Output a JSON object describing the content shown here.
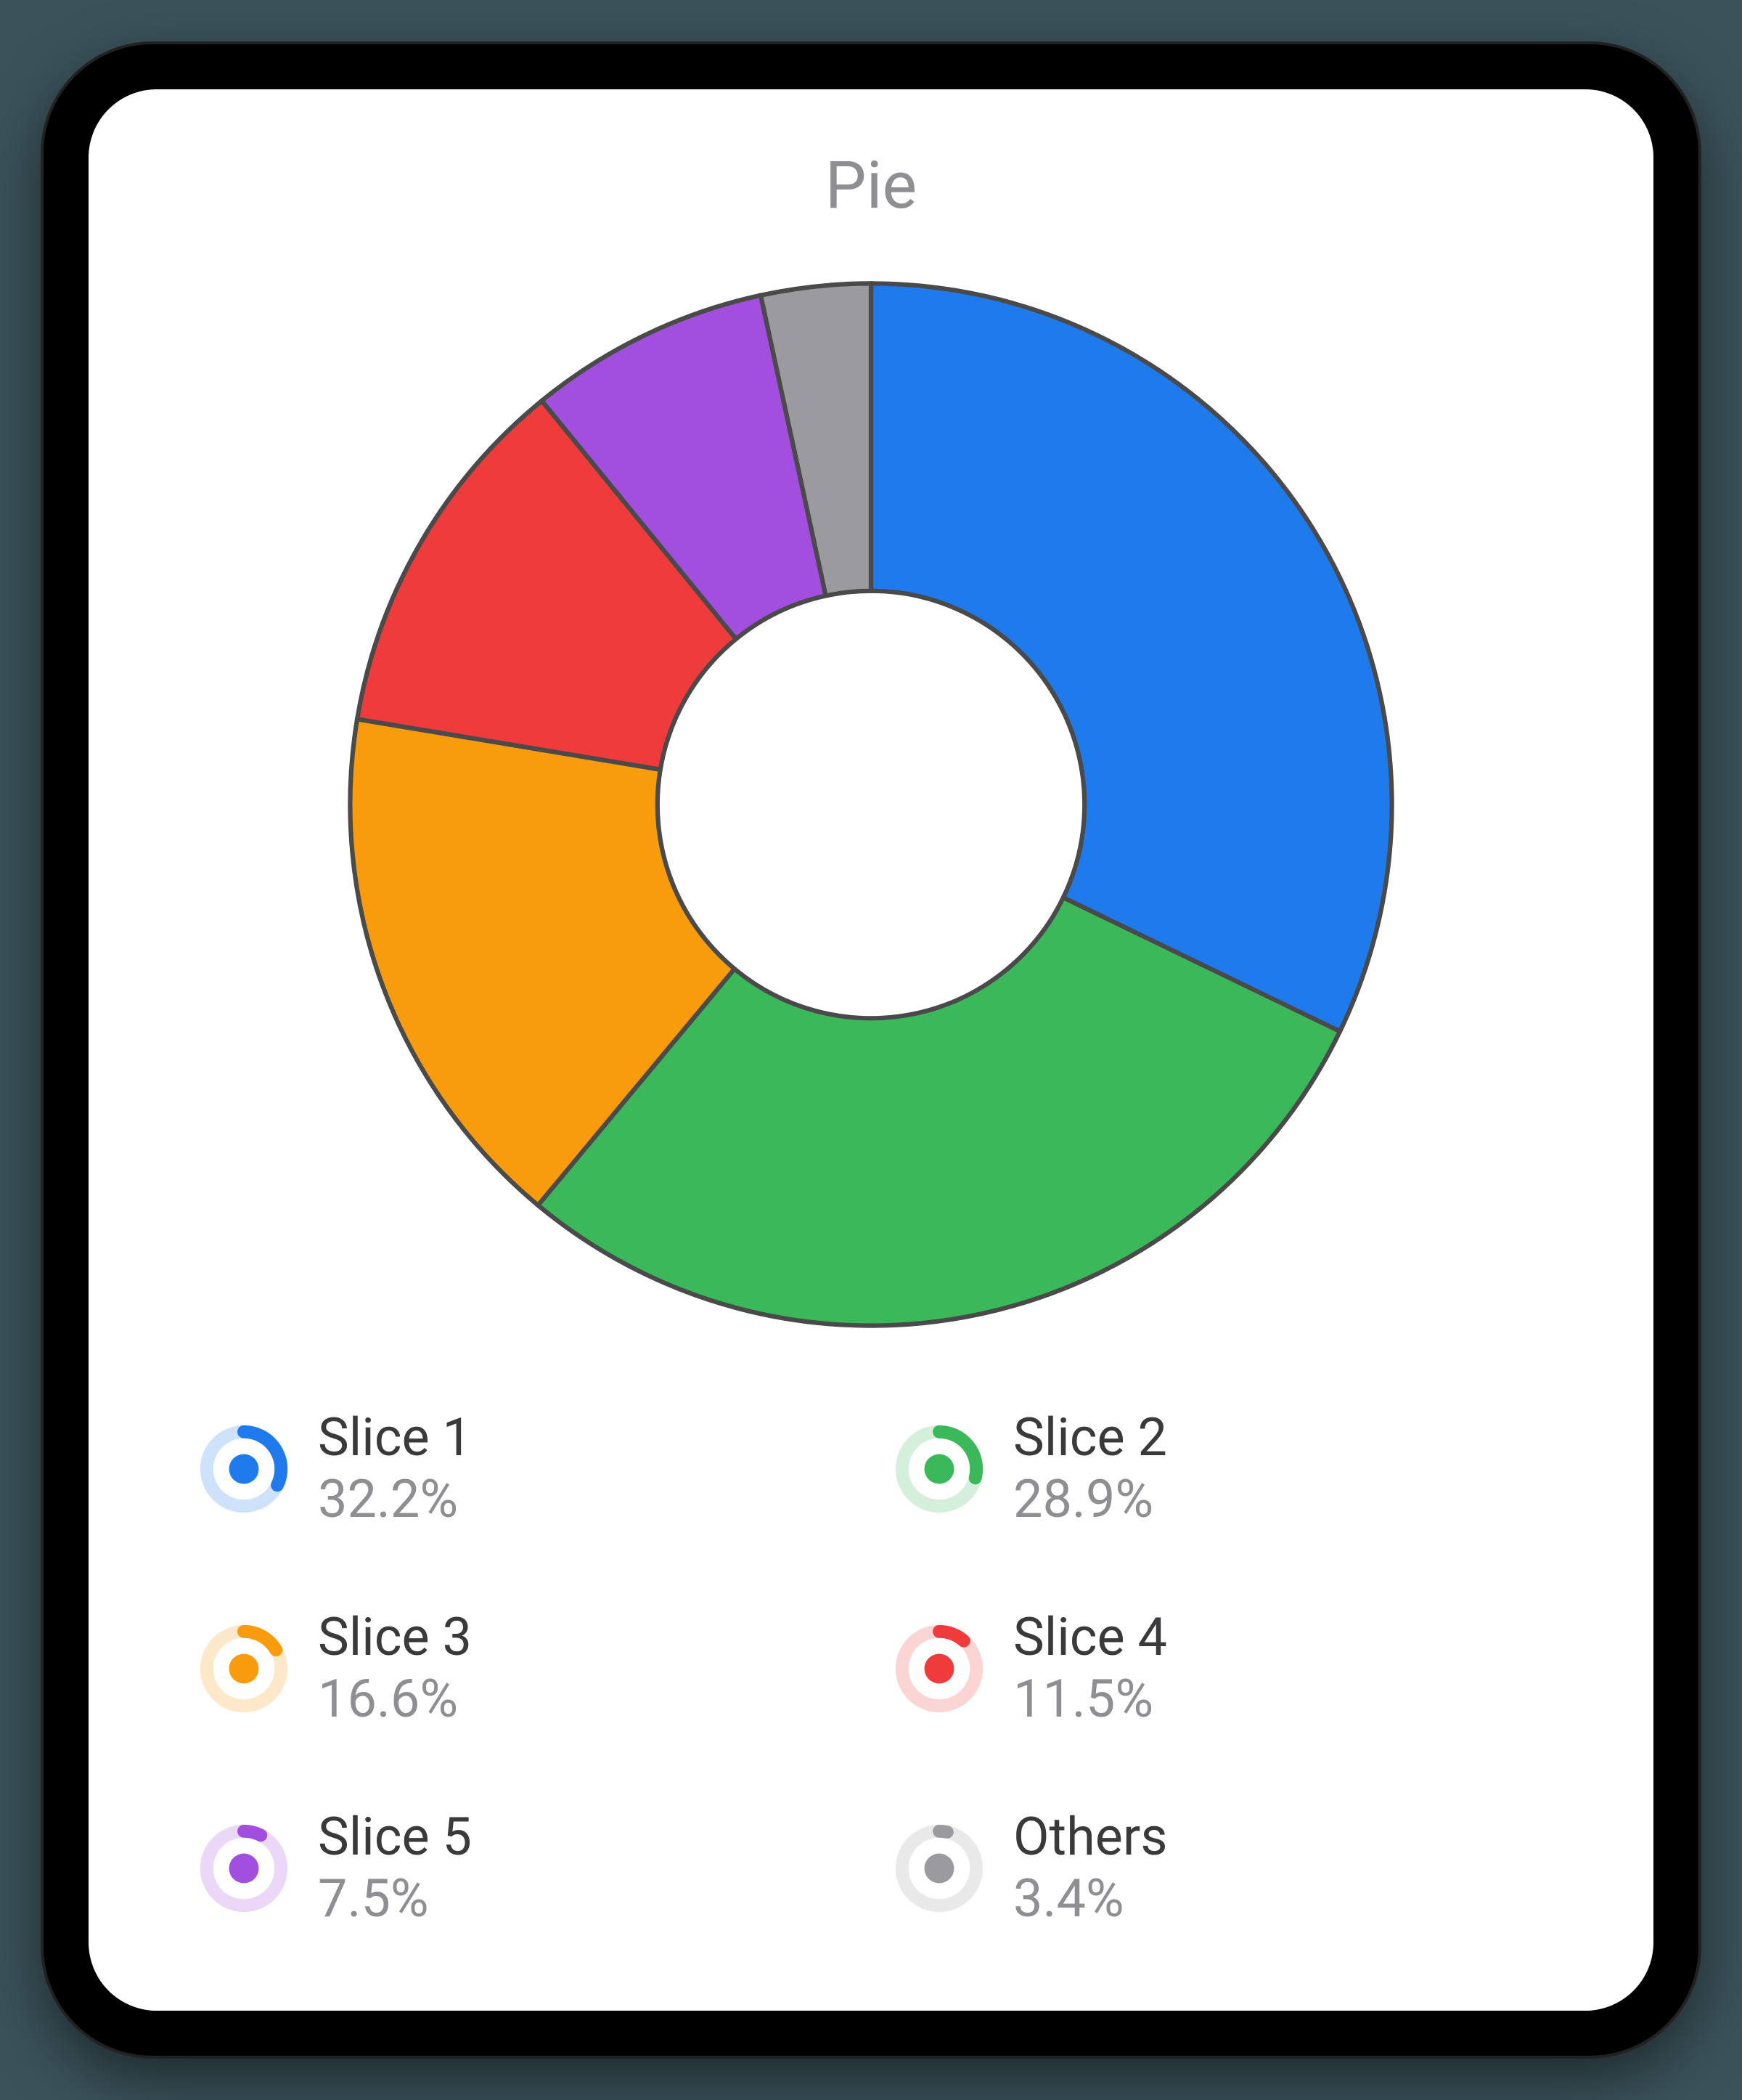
{
  "title": "Pie",
  "chart_data": {
    "type": "pie",
    "title": "Pie",
    "donut": true,
    "inner_radius_ratio": 0.41,
    "series": [
      {
        "name": "Slice 1",
        "value": 32.2,
        "color": "#1f7bec"
      },
      {
        "name": "Slice 2",
        "value": 28.9,
        "color": "#3bb85a"
      },
      {
        "name": "Slice 3",
        "value": 16.6,
        "color": "#f89c0e"
      },
      {
        "name": "Slice 4",
        "value": 11.5,
        "color": "#ef3b3b"
      },
      {
        "name": "Slice 5",
        "value": 7.5,
        "color": "#a24fe0"
      },
      {
        "name": "Others",
        "value": 3.4,
        "color": "#9a9a9f"
      }
    ]
  },
  "legend": [
    {
      "label": "Slice 1",
      "value": "32.2%"
    },
    {
      "label": "Slice 2",
      "value": "28.9%"
    },
    {
      "label": "Slice 3",
      "value": "16.6%"
    },
    {
      "label": "Slice 4",
      "value": "11.5%"
    },
    {
      "label": "Slice 5",
      "value": "7.5%"
    },
    {
      "label": "Others",
      "value": "3.4%"
    }
  ]
}
